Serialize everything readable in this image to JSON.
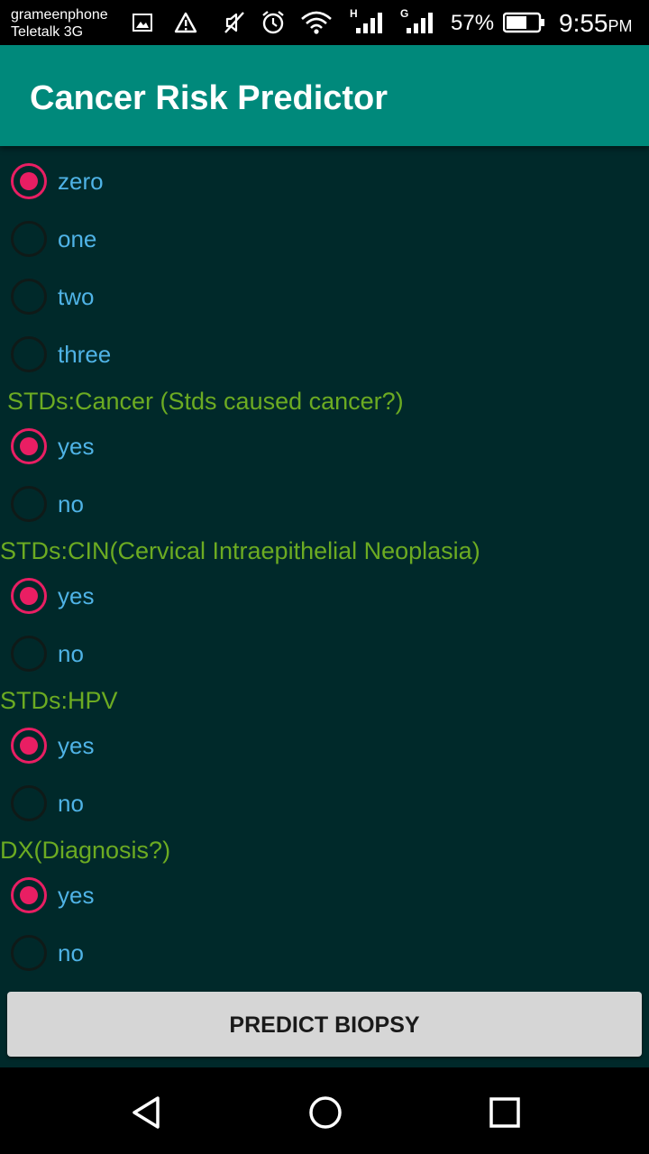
{
  "statusbar": {
    "carrier1": "grameenphone",
    "carrier2": "Teletalk 3G",
    "net1": "H",
    "net2": "G",
    "battery": "57%",
    "time": "9:55",
    "ampm": "PM"
  },
  "appbar": {
    "title": "Cancer Risk Predictor"
  },
  "questions": [
    {
      "label": "",
      "options": [
        {
          "label": "zero",
          "checked": true
        },
        {
          "label": "one",
          "checked": false
        },
        {
          "label": "two",
          "checked": false
        },
        {
          "label": "three",
          "checked": false
        }
      ]
    },
    {
      "label": "STDs:Cancer (Stds caused cancer?)",
      "options": [
        {
          "label": "yes",
          "checked": true
        },
        {
          "label": "no",
          "checked": false
        }
      ]
    },
    {
      "label": "STDs:CIN(Cervical Intraepithelial Neoplasia)",
      "options": [
        {
          "label": "yes",
          "checked": true
        },
        {
          "label": "no",
          "checked": false
        }
      ]
    },
    {
      "label": "STDs:HPV",
      "options": [
        {
          "label": "yes",
          "checked": true
        },
        {
          "label": "no",
          "checked": false
        }
      ]
    },
    {
      "label": "DX(Diagnosis?)",
      "options": [
        {
          "label": "yes",
          "checked": true
        },
        {
          "label": "no",
          "checked": false
        }
      ]
    }
  ],
  "predict_button": "PREDICT BIOPSY",
  "colors": {
    "appbar": "#00897b",
    "accent": "#e91e63",
    "question_text": "#6cab22",
    "option_text": "#4fb3e6",
    "background": "#00292a"
  },
  "navigation": {
    "back_icon": "back-icon",
    "home_icon": "home-icon",
    "recents_icon": "recents-icon"
  }
}
